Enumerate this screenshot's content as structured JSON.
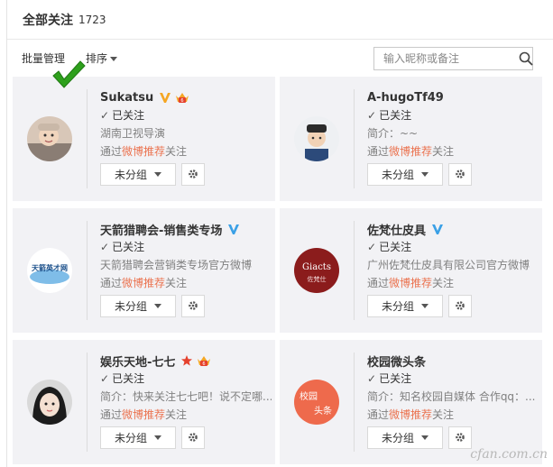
{
  "header": {
    "title": "全部关注",
    "count": "1723"
  },
  "toolbar": {
    "batch_label": "批量管理",
    "sort_label": "排序"
  },
  "search": {
    "placeholder": "输入昵称或备注"
  },
  "cards": [
    {
      "name": "Sukatsu",
      "followed": "已关注",
      "desc": "湖南卫视导演",
      "via_prefix": "通过",
      "via_link": "微博推荐",
      "via_suffix": "关注",
      "group": "未分组",
      "badges": [
        "v-yellow-icon",
        "vip-crown-icon"
      ]
    },
    {
      "name": "A-hugoTf49",
      "followed": "已关注",
      "desc": "简介：~~",
      "via_prefix": "通过",
      "via_link": "微博推荐",
      "via_suffix": "关注",
      "group": "未分组",
      "badges": []
    },
    {
      "name": "天箭猎聘会-销售类专场",
      "followed": "已关注",
      "desc": "天箭猎聘会营销类专场官方微博",
      "via_prefix": "通过",
      "via_link": "微博推荐",
      "via_suffix": "关注",
      "group": "未分组",
      "badges": [
        "v-blue-icon"
      ],
      "avatar_text": "天箭英才网"
    },
    {
      "name": "佐梵仕皮具",
      "followed": "已关注",
      "desc": "广州佐梵仕皮具有限公司官方微博",
      "via_prefix": "通过",
      "via_link": "微博推荐",
      "via_suffix": "关注",
      "group": "未分组",
      "badges": [
        "v-blue-icon"
      ],
      "avatar_text": "Giacts",
      "avatar_sub": "佐梵仕"
    },
    {
      "name": "娱乐天地-七七",
      "followed": "已关注",
      "desc": "简介：快来关注七七吧！说不定哪...",
      "via_prefix": "通过",
      "via_link": "微博推荐",
      "via_suffix": "关注",
      "group": "未分组",
      "badges": [
        "star-red-icon",
        "vip-crown-icon"
      ]
    },
    {
      "name": "校园微头条",
      "followed": "已关注",
      "desc": "简介：知名校园自媒体 合作qq：...",
      "via_prefix": "通过",
      "via_link": "微博推荐",
      "via_suffix": "关注",
      "group": "未分组",
      "badges": [],
      "avatar_text": "校园",
      "avatar_sub": "头条"
    }
  ],
  "watermark": "cfan.com.cn",
  "colors": {
    "highlight": "#eb7350",
    "verified_blue": "#3aa0e6",
    "verified_yellow": "#f5a623",
    "check_green": "#2ea01c"
  }
}
